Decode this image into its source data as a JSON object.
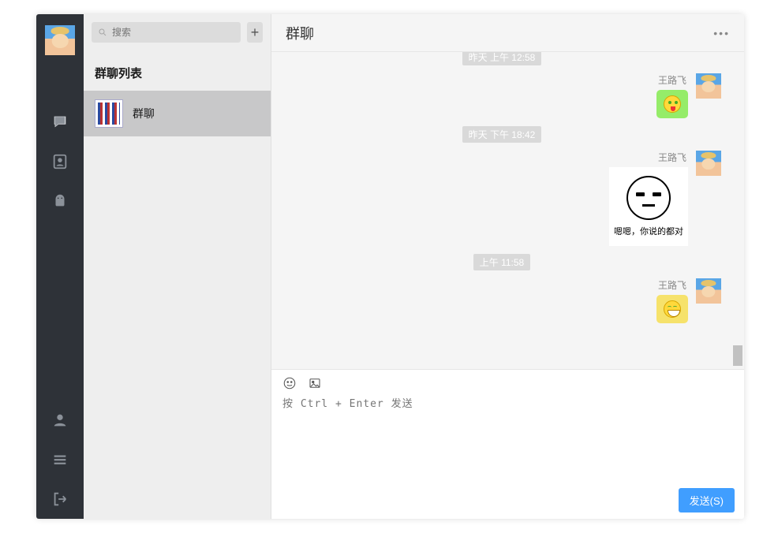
{
  "search": {
    "placeholder": "搜索"
  },
  "sidebar_section_title": "群聊列表",
  "conversations": [
    {
      "name": "群聊",
      "active": true
    }
  ],
  "chat": {
    "title": "群聊",
    "timeline": [
      {
        "time_cut": "昨天 上午 12:58"
      },
      {
        "sender": "王路飞",
        "kind": "emoji",
        "style": "green",
        "emoji": "tongue"
      },
      {
        "time": "昨天 下午 18:42"
      },
      {
        "sender": "王路飞",
        "kind": "meme",
        "caption": "嗯嗯，你说的都对"
      },
      {
        "time": "上午 11:58"
      },
      {
        "sender": "王路飞",
        "kind": "emoji",
        "style": "yellow",
        "emoji": "grin"
      }
    ]
  },
  "compose": {
    "placeholder": "按 Ctrl + Enter 发送",
    "send_label": "发送(S)"
  },
  "icons": {
    "add": "+",
    "more": "•••"
  }
}
